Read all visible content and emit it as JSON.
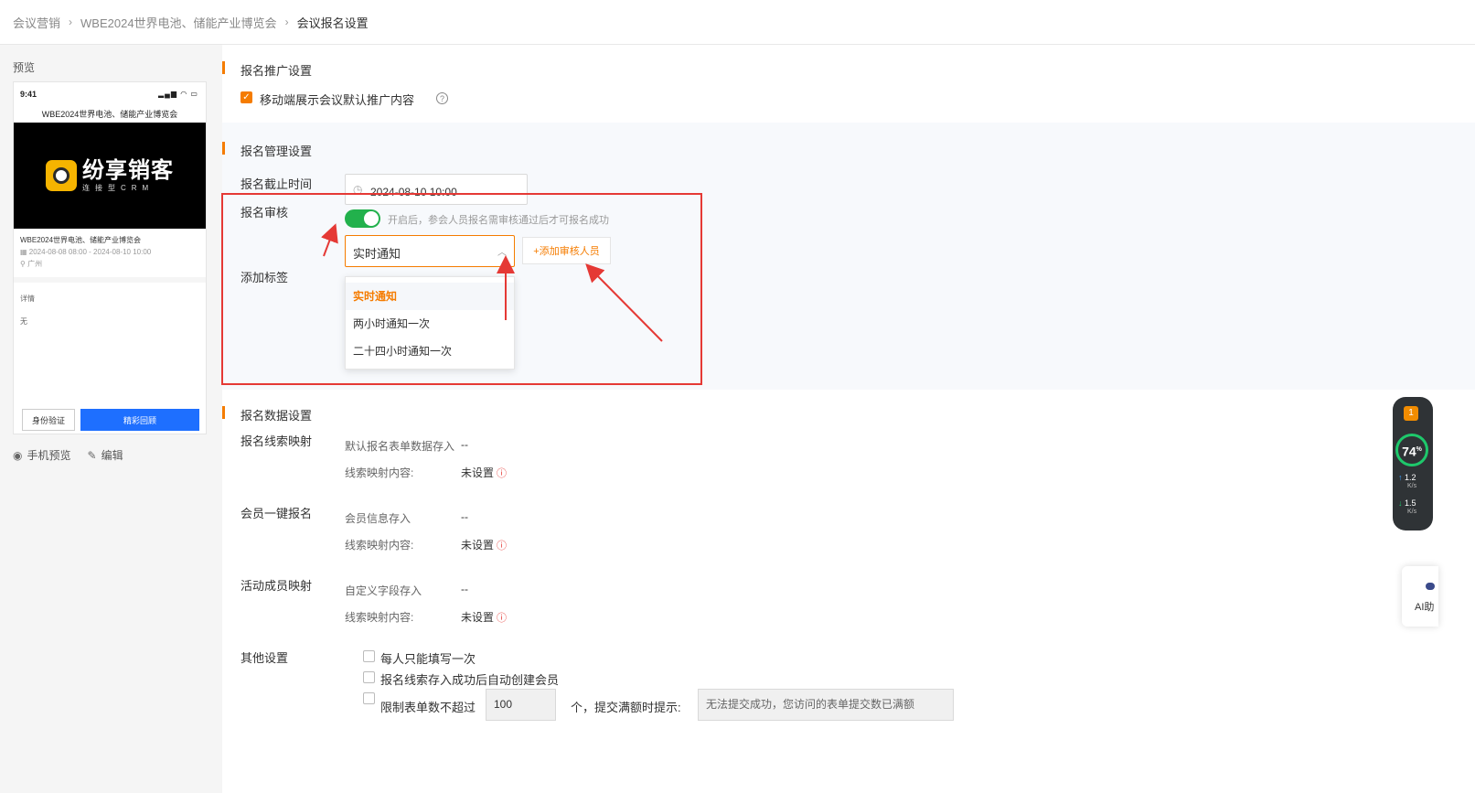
{
  "breadcrumb": {
    "items": [
      "会议营销",
      "WBE2024世界电池、储能产业博览会",
      "会议报名设置"
    ],
    "separator": "›"
  },
  "preview": {
    "title": "预览",
    "phone": {
      "time": "9:41",
      "status_icons": "▂▄▆ ◠ ▭",
      "page_title": "WBE2024世界电池、储能产业博览会",
      "banner_logo": "纷享销客",
      "banner_sub": "连接型CRM",
      "event_name": "WBE2024世界电池、储能产业博览会",
      "event_time": "2024-08-08 08:00 - 2024-08-10 10:00",
      "event_place": "广州",
      "detail_label": "详情",
      "detail_value": "无",
      "btn_verify": "身份验证",
      "btn_replay": "精彩回顾"
    },
    "actions": [
      {
        "icon": "eye-icon",
        "label": "手机预览"
      },
      {
        "icon": "edit-icon",
        "label": "编辑"
      }
    ]
  },
  "promo_section": {
    "title": "报名推广设置",
    "checkbox_label": "移动端展示会议默认推广内容",
    "checked": true
  },
  "manage_section": {
    "title": "报名管理设置",
    "deadline_label": "报名截止时间",
    "deadline_value": "2024-08-10 10:00",
    "review_label": "报名审核",
    "review_enabled": true,
    "review_hint": "开启后，参会人员报名需审核通过后才可报名成功",
    "notify_selected": "实时通知",
    "notify_options": [
      "实时通知",
      "两小时通知一次",
      "二十四小时通知一次"
    ],
    "add_reviewer": "+添加审核人员",
    "tag_label": "添加标签"
  },
  "data_section": {
    "title": "报名数据设置",
    "groups": [
      {
        "label": "报名线索映射",
        "rows": [
          {
            "key": "默认报名表单数据存入",
            "value": "--"
          },
          {
            "key": "线索映射内容:",
            "value": "未设置"
          }
        ]
      },
      {
        "label": "会员一键报名",
        "rows": [
          {
            "key": "会员信息存入",
            "value": "--"
          },
          {
            "key": "线索映射内容:",
            "value": "未设置"
          }
        ]
      },
      {
        "label": "活动成员映射",
        "rows": [
          {
            "key": "自定义字段存入",
            "value": "--"
          },
          {
            "key": "线索映射内容:",
            "value": "未设置"
          }
        ]
      }
    ],
    "other_label": "其他设置",
    "other_options": [
      "每人只能填写一次",
      "报名线索存入成功后自动创建会员",
      "限制表单数不超过"
    ],
    "limit_value": "100",
    "limit_suffix": "个，提交满额时提示:",
    "limit_message": "无法提交成功，您访问的表单提交数已满额"
  },
  "float_widget": {
    "badge": "1",
    "percent": "74",
    "percent_unit": "%",
    "up_speed": "1.2",
    "down_speed": "1.5",
    "speed_unit": "K/s"
  },
  "ai_button": {
    "label": "AI助"
  },
  "colors": {
    "accent": "#f57c00",
    "toggle_on": "#22b14c",
    "primary_blue": "#1e6fff",
    "annotation_red": "#e53935"
  }
}
